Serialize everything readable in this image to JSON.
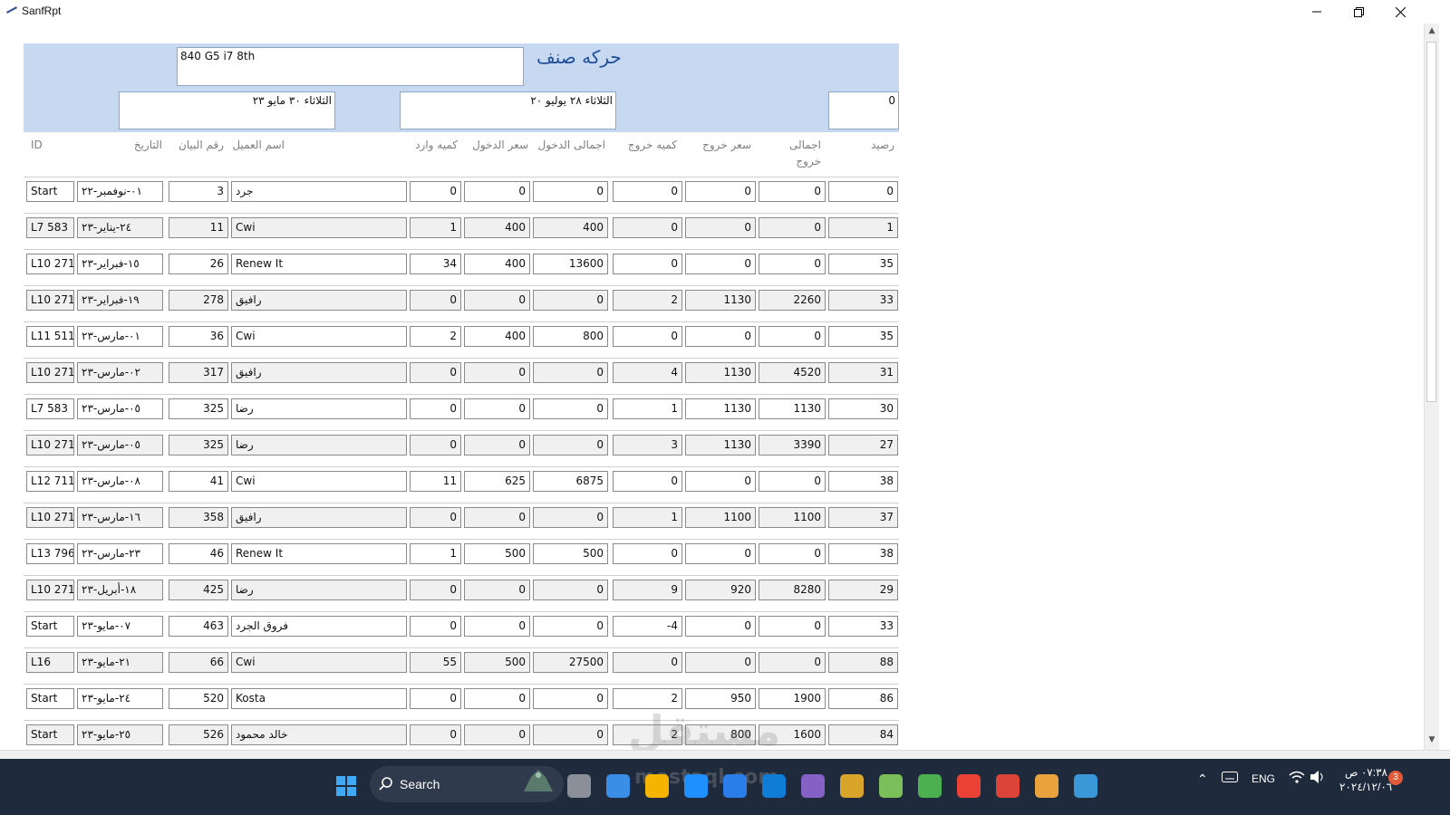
{
  "window": {
    "title": "SanfRpt"
  },
  "report": {
    "title": "حركه صنف",
    "item_name": "840 G5 i7 8th",
    "date_from": "الثلاثاء ٢٨ يوليو ٢٠",
    "date_to": "الثلاثاء ٣٠ مايو ٢٣",
    "opening_balance": "0",
    "columns": {
      "balance": "رصيد",
      "total_out_line1": "اجمالى",
      "total_out_line2": "خروج",
      "price_out": "سعر خروج",
      "qty_out": "كميه خروج",
      "total_in": "اجمالى الدخول",
      "price_in": "سعر الدخول",
      "qty_in": "كميه وارد",
      "customer": "اسم العميل",
      "statement_no": "رقم البيان",
      "date": "التاريخ",
      "id": "ID"
    },
    "rows": [
      {
        "id": "Start",
        "date": "٠١-نوفمبر-٢٢",
        "no": "3",
        "customer": "جرد",
        "qty_in": "0",
        "price_in": "0",
        "total_in": "0",
        "qty_out": "0",
        "price_out": "0",
        "total_out": "0",
        "balance": "0"
      },
      {
        "id": "L7 583",
        "date": "٢٤-يناير-٢٣",
        "no": "11",
        "customer": "Cwi",
        "qty_in": "1",
        "price_in": "400",
        "total_in": "400",
        "qty_out": "0",
        "price_out": "0",
        "total_out": "0",
        "balance": "1"
      },
      {
        "id": "L10 271",
        "date": "١٥-فبراير-٢٣",
        "no": "26",
        "customer": "Renew It",
        "qty_in": "34",
        "price_in": "400",
        "total_in": "13600",
        "qty_out": "0",
        "price_out": "0",
        "total_out": "0",
        "balance": "35"
      },
      {
        "id": "L10 271",
        "date": "١٩-فبراير-٢٣",
        "no": "278",
        "customer": "رافيق",
        "qty_in": "0",
        "price_in": "0",
        "total_in": "0",
        "qty_out": "2",
        "price_out": "1130",
        "total_out": "2260",
        "balance": "33"
      },
      {
        "id": "L11 511",
        "date": "٠١-مارس-٢٣",
        "no": "36",
        "customer": "Cwi",
        "qty_in": "2",
        "price_in": "400",
        "total_in": "800",
        "qty_out": "0",
        "price_out": "0",
        "total_out": "0",
        "balance": "35"
      },
      {
        "id": "L10 271",
        "date": "٠٢-مارس-٢٣",
        "no": "317",
        "customer": "رافيق",
        "qty_in": "0",
        "price_in": "0",
        "total_in": "0",
        "qty_out": "4",
        "price_out": "1130",
        "total_out": "4520",
        "balance": "31"
      },
      {
        "id": "L7 583",
        "date": "٠٥-مارس-٢٣",
        "no": "325",
        "customer": "رضا",
        "qty_in": "0",
        "price_in": "0",
        "total_in": "0",
        "qty_out": "1",
        "price_out": "1130",
        "total_out": "1130",
        "balance": "30"
      },
      {
        "id": "L10 271",
        "date": "٠٥-مارس-٢٣",
        "no": "325",
        "customer": "رضا",
        "qty_in": "0",
        "price_in": "0",
        "total_in": "0",
        "qty_out": "3",
        "price_out": "1130",
        "total_out": "3390",
        "balance": "27"
      },
      {
        "id": "L12 711",
        "date": "٠٨-مارس-٢٣",
        "no": "41",
        "customer": "Cwi",
        "qty_in": "11",
        "price_in": "625",
        "total_in": "6875",
        "qty_out": "0",
        "price_out": "0",
        "total_out": "0",
        "balance": "38"
      },
      {
        "id": "L10 271",
        "date": "١٦-مارس-٢٣",
        "no": "358",
        "customer": "رافيق",
        "qty_in": "0",
        "price_in": "0",
        "total_in": "0",
        "qty_out": "1",
        "price_out": "1100",
        "total_out": "1100",
        "balance": "37"
      },
      {
        "id": "L13 796",
        "date": "٢٣-مارس-٢٣",
        "no": "46",
        "customer": "Renew It",
        "qty_in": "1",
        "price_in": "500",
        "total_in": "500",
        "qty_out": "0",
        "price_out": "0",
        "total_out": "0",
        "balance": "38"
      },
      {
        "id": "L10 271",
        "date": "١٨-أبريل-٢٣",
        "no": "425",
        "customer": "رضا",
        "qty_in": "0",
        "price_in": "0",
        "total_in": "0",
        "qty_out": "9",
        "price_out": "920",
        "total_out": "8280",
        "balance": "29"
      },
      {
        "id": "Start",
        "date": "٠٧-مايو-٢٣",
        "no": "463",
        "customer": "فروق الجرد",
        "qty_in": "0",
        "price_in": "0",
        "total_in": "0",
        "qty_out": "-4",
        "price_out": "0",
        "total_out": "0",
        "balance": "33"
      },
      {
        "id": "L16",
        "date": "٢١-مايو-٢٣",
        "no": "66",
        "customer": "Cwi",
        "qty_in": "55",
        "price_in": "500",
        "total_in": "27500",
        "qty_out": "0",
        "price_out": "0",
        "total_out": "0",
        "balance": "88"
      },
      {
        "id": "Start",
        "date": "٢٤-مايو-٢٣",
        "no": "520",
        "customer": "Kosta",
        "qty_in": "0",
        "price_in": "0",
        "total_in": "0",
        "qty_out": "2",
        "price_out": "950",
        "total_out": "1900",
        "balance": "86"
      },
      {
        "id": "Start",
        "date": "٢٥-مايو-٢٣",
        "no": "526",
        "customer": "خالد محمود",
        "qty_in": "0",
        "price_in": "0",
        "total_in": "0",
        "qty_out": "2",
        "price_out": "800",
        "total_out": "1600",
        "balance": "84"
      }
    ]
  },
  "taskbar": {
    "search_label": "Search",
    "language": "ENG",
    "time": "٠٧:٣٨ ص",
    "date": "٢٠٢٤/١٢/٠٦",
    "notification_count": "3",
    "watermark_ar": "مستقل",
    "watermark_en": "mostaql.com",
    "apps": [
      "start-icon",
      "search-icon",
      "desktop-icon",
      "teams-icon",
      "file-explorer-icon",
      "edge-icon",
      "store-icon",
      "vscode-icon",
      "visual-studio-icon",
      "paint-icon",
      "tool-icon",
      "chat-icon",
      "chrome-icon",
      "chrome-alt-icon",
      "folder-icon",
      "maps-icon"
    ]
  },
  "colors": {
    "header_band": "#c6d9f1",
    "title": "#1f4e9b",
    "taskbar": "#1f2b3d"
  }
}
